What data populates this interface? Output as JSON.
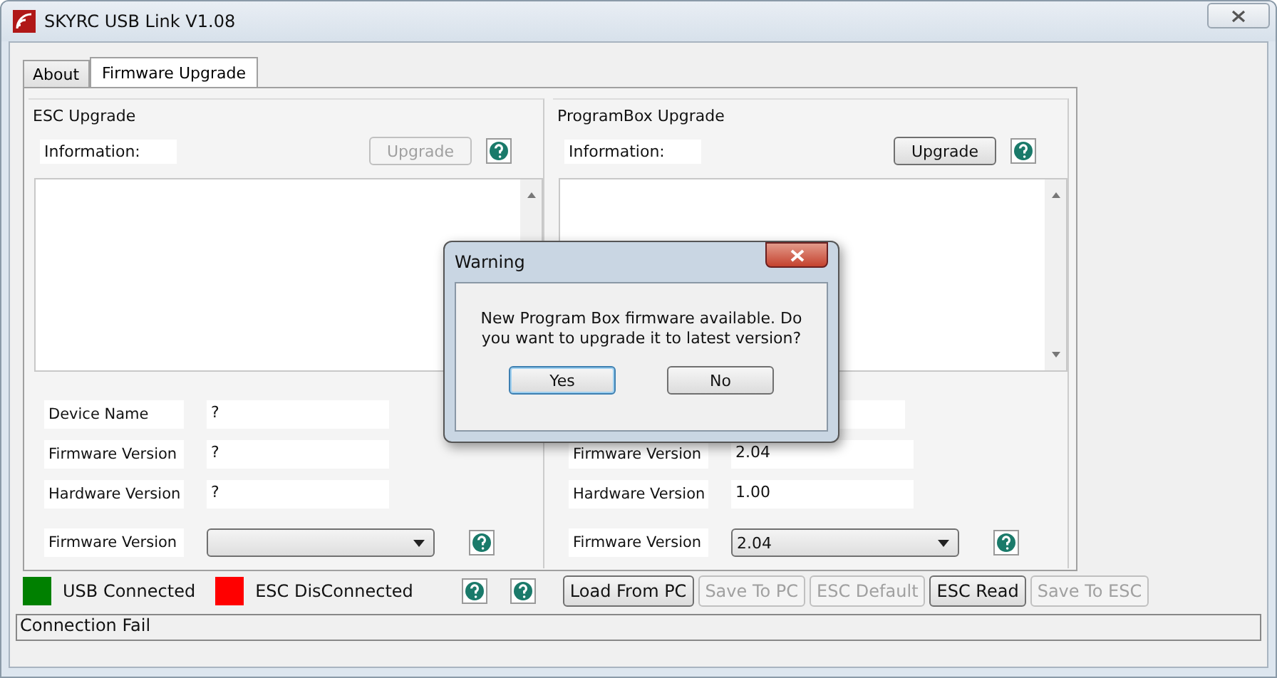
{
  "window": {
    "title": "SKYRC USB Link V1.08"
  },
  "tabs": [
    {
      "label": "About",
      "selected": false
    },
    {
      "label": "Firmware Upgrade",
      "selected": true
    }
  ],
  "groups": [
    {
      "title": "ESC Upgrade",
      "info_label": "Information:",
      "upgrade": {
        "label": "Upgrade",
        "disabled": true
      },
      "fields": [
        {
          "label": "Device Name",
          "value": "?"
        },
        {
          "label": "Firmware Version",
          "value": "?"
        },
        {
          "label": "Hardware Version",
          "value": "?"
        }
      ],
      "version_select": {
        "label": "Firmware Version"
      }
    },
    {
      "title": "ProgramBox Upgrade",
      "scroll_down_arrow": true,
      "info_label": "Information:",
      "upgrade": {
        "label": "Upgrade",
        "disabled": false
      },
      "fields": [
        {
          "kind": "blank"
        },
        {
          "label": "Firmware Version",
          "value": "2.04"
        },
        {
          "label": "Hardware Version",
          "value": "1.00"
        }
      ],
      "version_select": {
        "label": "Firmware Version",
        "value": "2.04"
      }
    }
  ],
  "indicators": [
    {
      "label": "USB Connected",
      "color": "#008000"
    },
    {
      "label": "ESC DisConnected",
      "color": "#ff0000"
    }
  ],
  "buttons": [
    {
      "label": "Load From PC",
      "disabled": false
    },
    {
      "label": "Save To PC",
      "disabled": true
    },
    {
      "label": "ESC Default",
      "disabled": true
    },
    {
      "label": "ESC Read",
      "disabled": false
    },
    {
      "label": "Save To ESC",
      "disabled": true
    }
  ],
  "status_bar": "Connection Fail",
  "dialog": {
    "title": "Warning",
    "message": "New Program Box  firmware available. Do you want to upgrade it to latest version?",
    "buttons": [
      {
        "label": "Yes",
        "selected": true
      },
      {
        "label": "No",
        "selected": false
      }
    ]
  }
}
